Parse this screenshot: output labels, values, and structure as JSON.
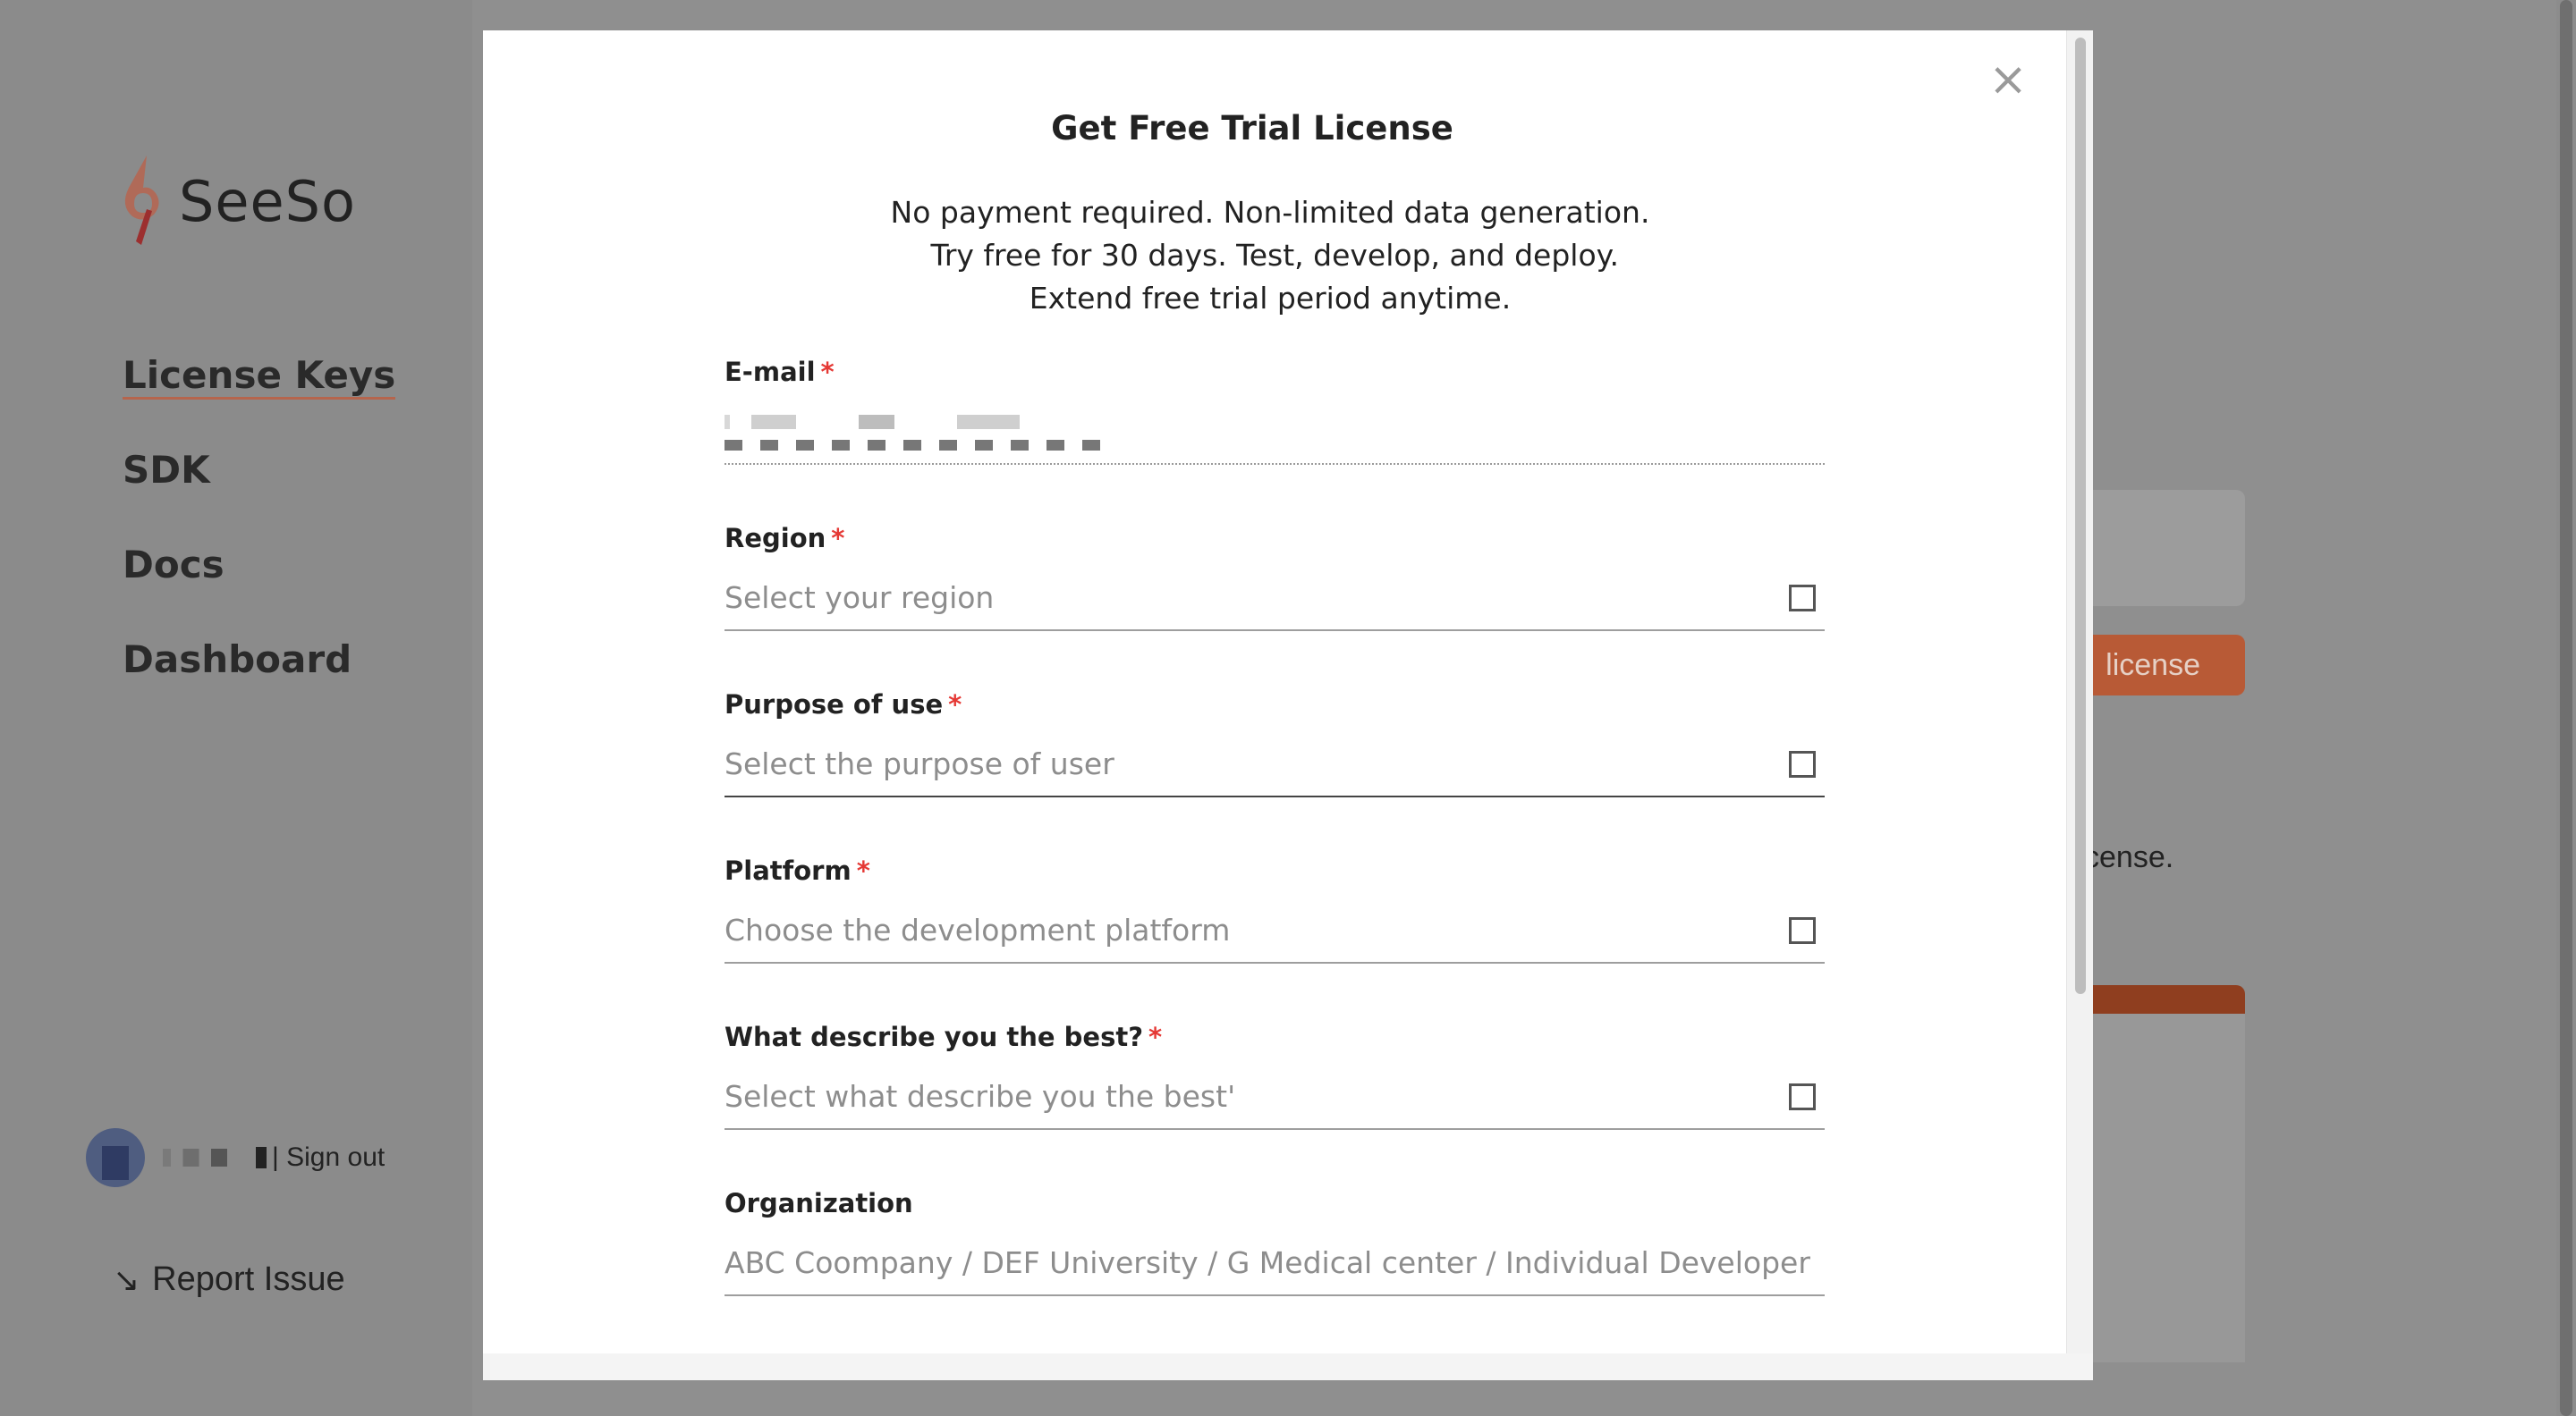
{
  "app": {
    "logo_text": "SeeSo",
    "nav": [
      {
        "label": "License Keys",
        "active": true
      },
      {
        "label": "SDK",
        "active": false
      },
      {
        "label": "Docs",
        "active": false
      },
      {
        "label": "Dashboard",
        "active": false
      }
    ],
    "user": {
      "signout_label": "| Sign out"
    },
    "report_issue_label": "Report Issue",
    "background": {
      "license_button_label": "license",
      "partial_text": "cense."
    }
  },
  "modal": {
    "title": "Get Free Trial License",
    "description": [
      "No payment required. Non-limited data generation.",
      " Try free for 30 days. Test, develop, and deploy.",
      "Extend free trial period anytime."
    ],
    "close_icon": "close-icon",
    "fields": {
      "email": {
        "label": "E-mail",
        "required_mark": "*",
        "value_redacted": true
      },
      "region": {
        "label": "Region",
        "required_mark": "*",
        "placeholder": "Select your region"
      },
      "purpose": {
        "label": "Purpose of use",
        "required_mark": "*",
        "placeholder": "Select the purpose of user"
      },
      "platform": {
        "label": "Platform",
        "required_mark": "*",
        "placeholder": "Choose the development platform"
      },
      "describe": {
        "label": "What describe you the best?",
        "required_mark": "*",
        "placeholder": "Select what describe you the best'"
      },
      "organization": {
        "label": "Organization",
        "placeholder": "ABC Coompany / DEF University / G Medical center / Individual Developer"
      }
    }
  },
  "colors": {
    "brand_accent": "#b85a36",
    "required": "#e53935",
    "overlay": "#8e8e8e"
  }
}
